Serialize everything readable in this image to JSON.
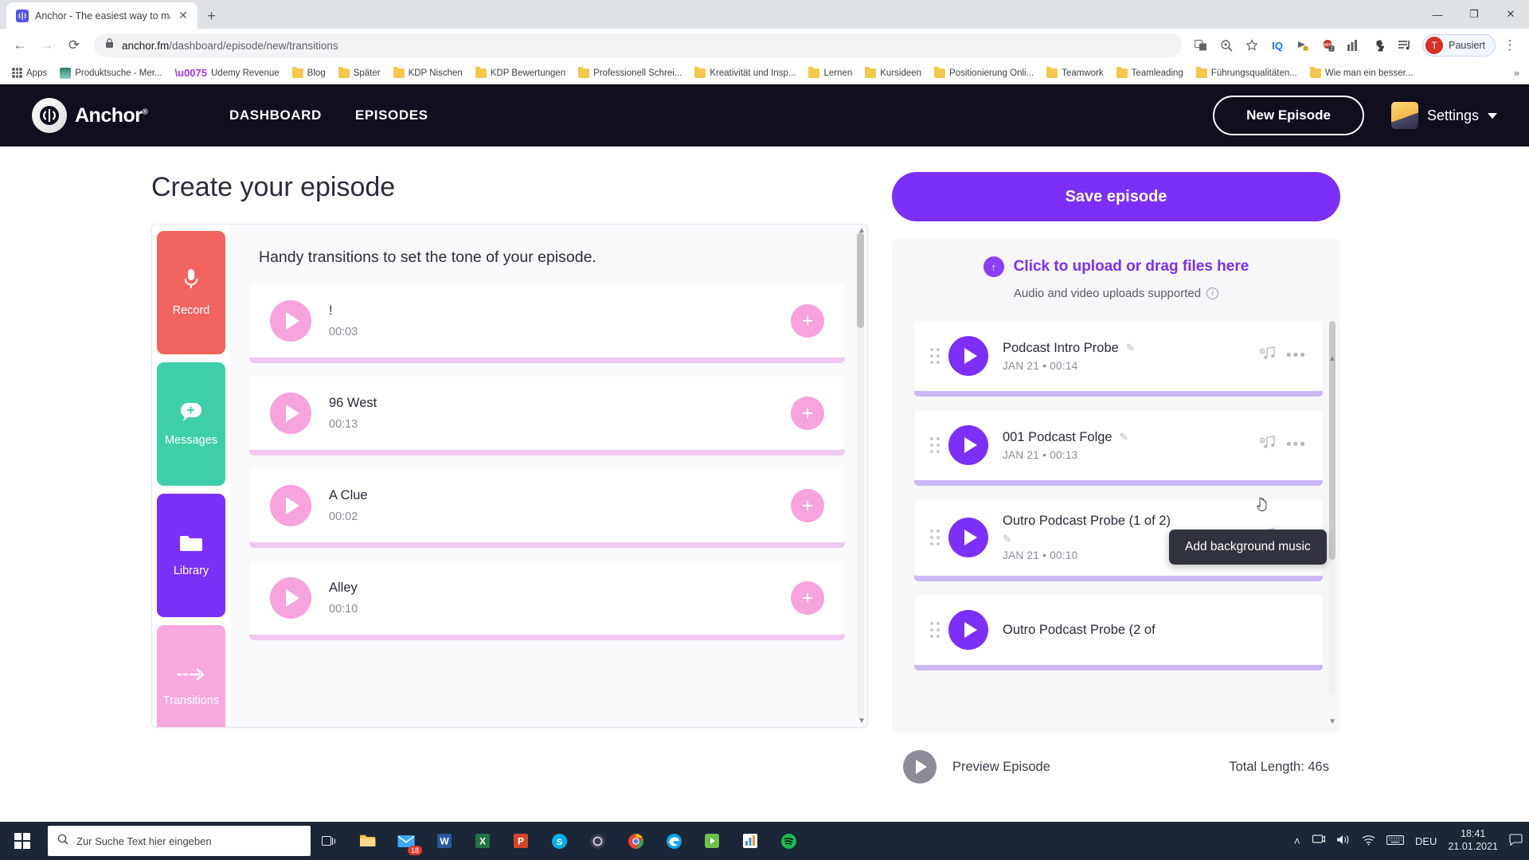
{
  "browser": {
    "tab": {
      "title": "Anchor - The easiest way to mak",
      "favicon": "anchor-icon",
      "close": "✕"
    },
    "new_tab": "+",
    "window_controls": {
      "minimize": "—",
      "maximize": "❐",
      "close": "✕"
    },
    "nav": {
      "back": "←",
      "forward": "→",
      "reload": "⟳"
    },
    "omnibox": {
      "lock": "🔒",
      "url_host": "anchor.fm",
      "url_path": "/dashboard/episode/new/transitions"
    },
    "toolbar_icons": [
      {
        "name": "translate-icon",
        "glyph": "⟦⟧"
      },
      {
        "name": "zoom-icon",
        "glyph": "⊕"
      },
      {
        "name": "bookmark-star-icon",
        "glyph": "☆"
      },
      {
        "name": "iq-extension-icon",
        "glyph": "IQ"
      },
      {
        "name": "pocket-extension-icon",
        "glyph": "➤"
      },
      {
        "name": "adblock-extension-icon",
        "glyph": "ABP"
      },
      {
        "name": "apps-grid-extension-icon",
        "glyph": "☷"
      },
      {
        "name": "puzzle-extensions-icon",
        "glyph": "🧩"
      },
      {
        "name": "playlist-extension-icon",
        "glyph": "☰"
      }
    ],
    "profile": {
      "initial": "T",
      "label": "Pausiert"
    },
    "menu": "⋮",
    "bookmarks": [
      {
        "label": "Apps",
        "icon": "apps-grid-icon",
        "color": "#5f6368"
      },
      {
        "label": "Produktsuche - Mer...",
        "icon": "site-icon",
        "color": "#2f7d6e"
      },
      {
        "label": "Udemy Revenue",
        "icon": "udemy-icon",
        "color": "#a435f0"
      },
      {
        "label": "Blog",
        "icon": "folder-icon",
        "color": "#f2c94c"
      },
      {
        "label": "Später",
        "icon": "folder-icon",
        "color": "#f2c94c"
      },
      {
        "label": "KDP Nischen",
        "icon": "folder-icon",
        "color": "#f2c94c"
      },
      {
        "label": "KDP Bewertungen",
        "icon": "folder-icon",
        "color": "#f2c94c"
      },
      {
        "label": "Professionell Schrei...",
        "icon": "folder-icon",
        "color": "#f2c94c"
      },
      {
        "label": "Kreativität und Insp...",
        "icon": "folder-icon",
        "color": "#f2c94c"
      },
      {
        "label": "Lernen",
        "icon": "folder-icon",
        "color": "#f2c94c"
      },
      {
        "label": "Kursideen",
        "icon": "folder-icon",
        "color": "#f2c94c"
      },
      {
        "label": "Positionierung Onli...",
        "icon": "folder-icon",
        "color": "#f2c94c"
      },
      {
        "label": "Teamwork",
        "icon": "folder-icon",
        "color": "#f2c94c"
      },
      {
        "label": "Teamleading",
        "icon": "folder-icon",
        "color": "#f2c94c"
      },
      {
        "label": "Führungsqualitäten...",
        "icon": "folder-icon",
        "color": "#f2c94c"
      },
      {
        "label": "Wie man ein besser...",
        "icon": "folder-icon",
        "color": "#f2c94c"
      }
    ],
    "bookmarks_overflow": "»"
  },
  "anchor": {
    "brand": "Anchor",
    "brand_sup": "®",
    "nav": [
      {
        "label": "DASHBOARD",
        "name": "nav-dashboard"
      },
      {
        "label": "EPISODES",
        "name": "nav-episodes"
      }
    ],
    "new_episode_button": "New Episode",
    "settings_label": "Settings",
    "page_title": "Create your episode",
    "tools": [
      {
        "label": "Record",
        "icon": "microphone-icon",
        "color": "#f4645f"
      },
      {
        "label": "Messages",
        "icon": "message-plus-icon",
        "color": "#3fcfa8"
      },
      {
        "label": "Library",
        "icon": "folder-icon",
        "color": "#7b2ff7"
      },
      {
        "label": "Transitions",
        "icon": "arrow-right-icon",
        "color": "#f9a8dd"
      }
    ],
    "transitions": {
      "heading": "Handy transitions to set the tone of your episode.",
      "add_glyph": "+",
      "items": [
        {
          "name": "!",
          "duration": "00:03"
        },
        {
          "name": "96 West",
          "duration": "00:13"
        },
        {
          "name": "A Clue",
          "duration": "00:02"
        },
        {
          "name": "Alley",
          "duration": "00:10"
        }
      ]
    },
    "save_episode_button": "Save episode",
    "upload": {
      "cta": "Click to upload or drag files here",
      "subtitle": "Audio and video uploads supported",
      "info_glyph": "i",
      "arrow_glyph": "↑"
    },
    "episodes": [
      {
        "title": "Podcast Intro Probe",
        "date": "JAN 21 • 00:14",
        "edit": "✎",
        "music": "add-music-icon",
        "more": "•••"
      },
      {
        "title": "001 Podcast Folge",
        "date": "JAN 21 • 00:13",
        "edit": "✎",
        "music": "add-music-icon",
        "more": "•••"
      },
      {
        "title": "Outro Podcast Probe (1 of 2)",
        "date": "JAN 21 • 00:10",
        "edit": "✎",
        "music": "add-music-icon",
        "more": "•••"
      },
      {
        "title": "Outro Podcast Probe (2 of",
        "date": "",
        "edit": "✎",
        "music": "add-music-icon",
        "more": "•••"
      }
    ],
    "tooltip": "Add background music",
    "player": {
      "preview_label": "Preview Episode",
      "total_length": "Total Length: 46s"
    }
  },
  "taskbar": {
    "search_placeholder": "Zur Suche Text hier eingeben",
    "search_icon": "search-icon",
    "apps": [
      {
        "name": "task-view-icon",
        "glyph": "☰",
        "color": "#e6e6e6"
      },
      {
        "name": "file-explorer-icon",
        "glyph": "📁",
        "color": "#f7c14b"
      },
      {
        "name": "mail-icon",
        "glyph": "✉",
        "color": "#3da9fc",
        "badge": "18"
      },
      {
        "name": "word-icon",
        "glyph": "W",
        "color": "#2b579a"
      },
      {
        "name": "excel-icon",
        "glyph": "X",
        "color": "#217346"
      },
      {
        "name": "powerpoint-icon",
        "glyph": "P",
        "color": "#d24726"
      },
      {
        "name": "skype-icon",
        "glyph": "S",
        "color": "#00aff0"
      },
      {
        "name": "obs-icon",
        "glyph": "◉",
        "color": "#9b9bb0"
      },
      {
        "name": "chrome-icon",
        "glyph": "●",
        "color": "#4285f4"
      },
      {
        "name": "edge-icon",
        "glyph": "e",
        "color": "#0ea5e9"
      },
      {
        "name": "camtasia-icon",
        "glyph": "▶",
        "color": "#6cc24a"
      },
      {
        "name": "analytics-icon",
        "glyph": "📊",
        "color": "#4a90d9"
      },
      {
        "name": "spotify-icon",
        "glyph": "♫",
        "color": "#1db954"
      }
    ],
    "tray": {
      "chevron": "˄",
      "screen_icon": "⬜",
      "volume_icon": "🔊",
      "wifi_icon": "📶",
      "keyboard_icon": "⌨",
      "language": "DEU",
      "time": "18:41",
      "date": "21.01.2021",
      "notification_icon": "💬"
    }
  }
}
